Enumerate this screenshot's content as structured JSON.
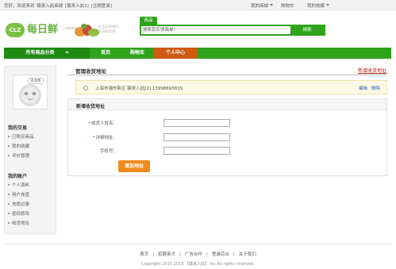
{
  "topbar": {
    "greeting": "您好，欢迎来到",
    "site_name": "猿来入此商城",
    "user": "[猿来入此1]",
    "logout": "[注销登录]",
    "my_store": "我的商城",
    "cart": "购物车",
    "favorites": "我的收藏"
  },
  "header": {
    "logo_badge": "CLZ",
    "logo_text": "每日鲜",
    "logo_sub": "freshfood",
    "slogan_line1": "生活与你相约",
    "slogan_line2": "每日鲜提供"
  },
  "search": {
    "tab_label": "商品",
    "placeholder": "搜索其实很简单！",
    "button_label": "搜索"
  },
  "nav": {
    "all_categories": "所有商品分类",
    "home": "首页",
    "cart": "购物车",
    "personal_center": "个人中心"
  },
  "sidebar": {
    "avatar_tag": "求具像",
    "trades_title": "我的交易",
    "trades_items": [
      "已购买商品",
      "我的收藏",
      "评价管理"
    ],
    "account_title": "我的账户",
    "account_items": [
      "个人资料",
      "用户充值",
      "充值记录",
      "密码修改",
      "收货地址"
    ]
  },
  "main": {
    "title": "管理收货地址",
    "add_link": "新增收货地址",
    "address": {
      "city": "上海市浦东新区",
      "name": "猿来入此[2]",
      "phone": "13998893839",
      "edit_label": "编辑",
      "delete_label": "删除"
    },
    "form": {
      "title": "新增收货地址",
      "recipient_label": "收货人姓名：",
      "detail_label": "详细地址：",
      "phone_label": "手机号：",
      "required_mark": "*",
      "submit_label": "增加地址"
    }
  },
  "footer": {
    "links": [
      "首页",
      "招聘英才",
      "广告合作",
      "登录后台",
      "关于我们"
    ],
    "copyright": "Copyright 2015-2019 【猿来入此】 Inc.All rights reserved."
  },
  "colors": {
    "primary_green": "#2fa31b",
    "dark_green": "#1e8a12",
    "active_orange": "#cf5a12",
    "button_orange": "#f08a1c",
    "link_red": "#b0250e",
    "link_blue": "#2a62b0"
  }
}
